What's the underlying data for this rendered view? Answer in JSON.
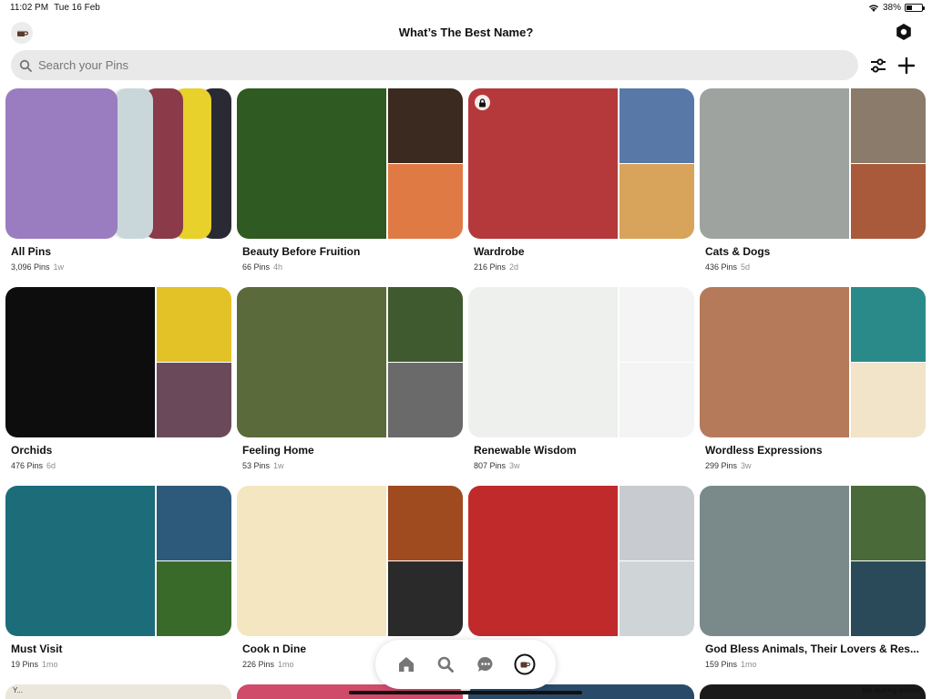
{
  "status_bar": {
    "time": "11:02 PM",
    "date": "Tue 16 Feb",
    "battery": "38%",
    "battery_level": 0.38
  },
  "header": {
    "title": "What’s The Best Name?"
  },
  "search": {
    "placeholder": "Search your Pins"
  },
  "boards": [
    {
      "name": "All Pins",
      "pins": "3,096 Pins",
      "age": "1w",
      "locked": false,
      "colors": [
        "#9a7cc0",
        "#c9d7da",
        "#8b3a4a",
        "#e8d12a",
        "#2a2a35"
      ]
    },
    {
      "name": "Beauty Before Fruition",
      "pins": "66 Pins",
      "age": "4h",
      "locked": false,
      "colors": [
        "#2f5a22",
        "#3a2a1f",
        "#e07a45"
      ]
    },
    {
      "name": "Wardrobe",
      "pins": "216 Pins",
      "age": "2d",
      "locked": true,
      "colors": [
        "#b5393b",
        "#5878a8",
        "#d8a35a"
      ]
    },
    {
      "name": "Cats & Dogs",
      "pins": "436 Pins",
      "age": "5d",
      "locked": false,
      "colors": [
        "#9fa3a0",
        "#8a7b6a",
        "#a85a3a"
      ]
    },
    {
      "name": "Orchids",
      "pins": "476 Pins",
      "age": "6d",
      "locked": false,
      "colors": [
        "#0d0d0d",
        "#e2c227",
        "#6a4a5a"
      ]
    },
    {
      "name": "Feeling Home",
      "pins": "53 Pins",
      "age": "1w",
      "locked": false,
      "colors": [
        "#5b6a3a",
        "#3e5a2e",
        "#6a6a6a"
      ]
    },
    {
      "name": "Renewable Wisdom",
      "pins": "807 Pins",
      "age": "3w",
      "locked": false,
      "colors": [
        "#eef0ee",
        "#f4f4f4",
        "#f4f4f4"
      ]
    },
    {
      "name": "Wordless Expressions",
      "pins": "299 Pins",
      "age": "3w",
      "locked": false,
      "colors": [
        "#b57a5a",
        "#2a8a8a",
        "#f1e4c8"
      ]
    },
    {
      "name": "Must Visit",
      "pins": "19 Pins",
      "age": "1mo",
      "locked": false,
      "colors": [
        "#1d6c7a",
        "#2d5a7a",
        "#3a6a2a"
      ]
    },
    {
      "name": "Cook n Dine",
      "pins": "226 Pins",
      "age": "1mo",
      "locked": false,
      "colors": [
        "#f3e6c0",
        "#a04a20",
        "#2a2a2a"
      ]
    },
    {
      "name": "",
      "pins": "",
      "age": "",
      "locked": false,
      "colors": [
        "#c02a2a",
        "#c8ccd0",
        "#cfd4d6"
      ]
    },
    {
      "name": "God Bless Animals, Their Lovers & Res...",
      "pins": "159 Pins",
      "age": "1mo",
      "locked": false,
      "colors": [
        "#7a8a8a",
        "#4a6a3a",
        "#2a4a5a"
      ]
    }
  ],
  "bottom_peek_colors": [
    "#ece7dd",
    "#d04a6a",
    "#2a4a6a",
    "#1a1a1a"
  ],
  "bottom_peek_text": {
    "left": "Y...",
    "right": "Me during online"
  },
  "tabs": [
    {
      "name": "home",
      "icon": "home-icon"
    },
    {
      "name": "search",
      "icon": "search-icon"
    },
    {
      "name": "messages",
      "icon": "chat-icon"
    },
    {
      "name": "profile",
      "icon": "avatar-icon"
    }
  ]
}
